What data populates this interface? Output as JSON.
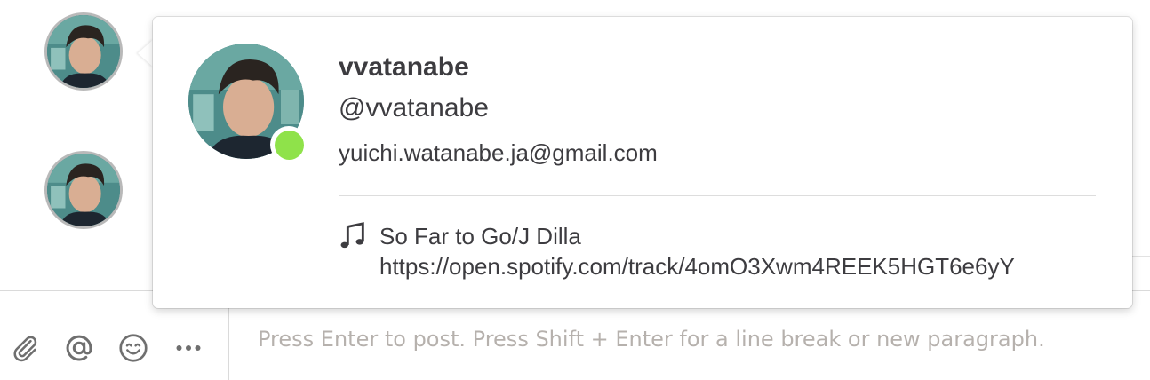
{
  "popover": {
    "display_name": "vvatanabe",
    "username": "@vvatanabe",
    "email": "yuichi.watanabe.ja@gmail.com",
    "status_online_color": "#8fe24a",
    "custom_status": {
      "icon": "music-note-icon",
      "line1": "So Far to Go/J Dilla",
      "line2": "https://open.spotify.com/track/4omO3Xwm4REEK5HGT6e6yY"
    }
  },
  "composer": {
    "placeholder": "Press Enter to post. Press Shift + Enter for a line break or new paragraph.",
    "tools": [
      {
        "name": "attachment",
        "icon": "paperclip-icon"
      },
      {
        "name": "mention",
        "icon": "at-sign-icon"
      },
      {
        "name": "emoji",
        "icon": "emoji-icon"
      },
      {
        "name": "more",
        "icon": "more-dots-icon"
      }
    ]
  }
}
